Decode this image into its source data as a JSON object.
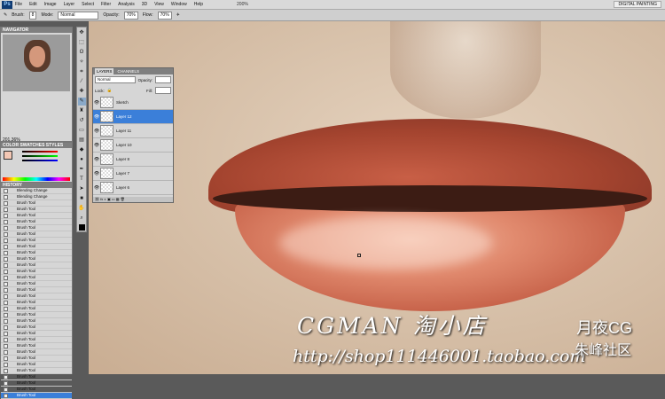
{
  "app": {
    "logo": "Ps",
    "zoom": "200%",
    "workspace": "DIGITAL PAINTING"
  },
  "menu": [
    "File",
    "Edit",
    "Image",
    "Layer",
    "Select",
    "Filter",
    "Analysis",
    "3D",
    "View",
    "Window",
    "Help"
  ],
  "options": {
    "brush_label": "Brush:",
    "brush_size": "8",
    "mode_label": "Mode:",
    "mode": "Normal",
    "opacity_label": "Opacity:",
    "opacity": "70%",
    "flow_label": "Flow:",
    "flow": "70%"
  },
  "navigator": {
    "title": "NAVIGATOR",
    "zoom": "201.36%"
  },
  "color_panel": {
    "title": "COLOR  SWATCHES  STYLES"
  },
  "history": {
    "title": "HISTORY",
    "items": [
      "Blending Change",
      "Blending Change",
      "Brush Tool",
      "Brush Tool",
      "Brush Tool",
      "Brush Tool",
      "Brush Tool",
      "Brush Tool",
      "Brush Tool",
      "Brush Tool",
      "Brush Tool",
      "Brush Tool",
      "Brush Tool",
      "Brush Tool",
      "Brush Tool",
      "Brush Tool",
      "Brush Tool",
      "Brush Tool",
      "Brush Tool",
      "Brush Tool",
      "Brush Tool",
      "Brush Tool",
      "Brush Tool",
      "Brush Tool",
      "Brush Tool",
      "Brush Tool",
      "Brush Tool",
      "Brush Tool",
      "Brush Tool",
      "Brush Tool",
      "Brush Tool",
      "Brush Tool",
      "Brush Tool"
    ],
    "selected": "Brush Tool"
  },
  "layers": {
    "tab_layers": "LAYERS",
    "tab_channels": "CHANNELS",
    "blend": "Normal",
    "opacity_label": "Opacity:",
    "lock_label": "Lock:",
    "fill_label": "Fill:",
    "items": [
      "Sketch",
      "Layer 12",
      "Layer 11",
      "Layer 10",
      "Layer 8",
      "Layer 7",
      "Layer 6"
    ],
    "selected": "Layer 12"
  },
  "watermark": {
    "line1": "CGMAN 淘小店",
    "line2": "月夜CG",
    "line3": "http://shop111446001.taobao.com",
    "line4": "朱峰社区"
  }
}
